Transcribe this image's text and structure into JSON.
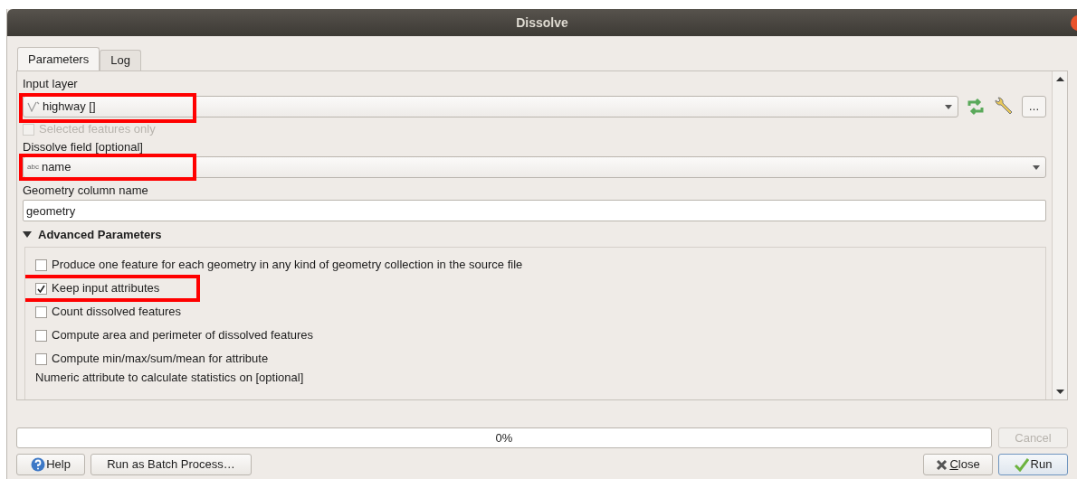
{
  "window": {
    "title": "Dissolve"
  },
  "tabs": [
    {
      "label": "Parameters",
      "selected": true
    },
    {
      "label": "Log",
      "selected": false
    }
  ],
  "input_layer": {
    "label": "Input layer",
    "value": "highway []",
    "highlighted": true,
    "selected_only": {
      "label": "Selected features only",
      "checked": false,
      "disabled": true
    },
    "more_button": "…"
  },
  "dissolve_field": {
    "label": "Dissolve field [optional]",
    "value": "name",
    "type_badge": "abc",
    "highlighted": true
  },
  "geometry_column": {
    "label": "Geometry column name",
    "value": "geometry"
  },
  "advanced": {
    "title": "Advanced Parameters",
    "expanded": true,
    "options": [
      {
        "label": "Produce one feature for each geometry in any kind of geometry collection in the source file",
        "checked": false,
        "highlighted": false
      },
      {
        "label": "Keep input attributes",
        "checked": true,
        "highlighted": true
      },
      {
        "label": "Count dissolved features",
        "checked": false,
        "highlighted": false
      },
      {
        "label": "Compute area and perimeter of dissolved features",
        "checked": false,
        "highlighted": false
      },
      {
        "label": "Compute min/max/sum/mean for attribute",
        "checked": false,
        "highlighted": false
      }
    ],
    "numeric_label": "Numeric attribute to calculate statistics on [optional]"
  },
  "progress": {
    "level": 0,
    "reading": "0%",
    "cancel": "Cancel"
  },
  "buttons": {
    "help": "Help",
    "batch": "Run as Batch Process…",
    "close": "Close",
    "run": "Run"
  }
}
